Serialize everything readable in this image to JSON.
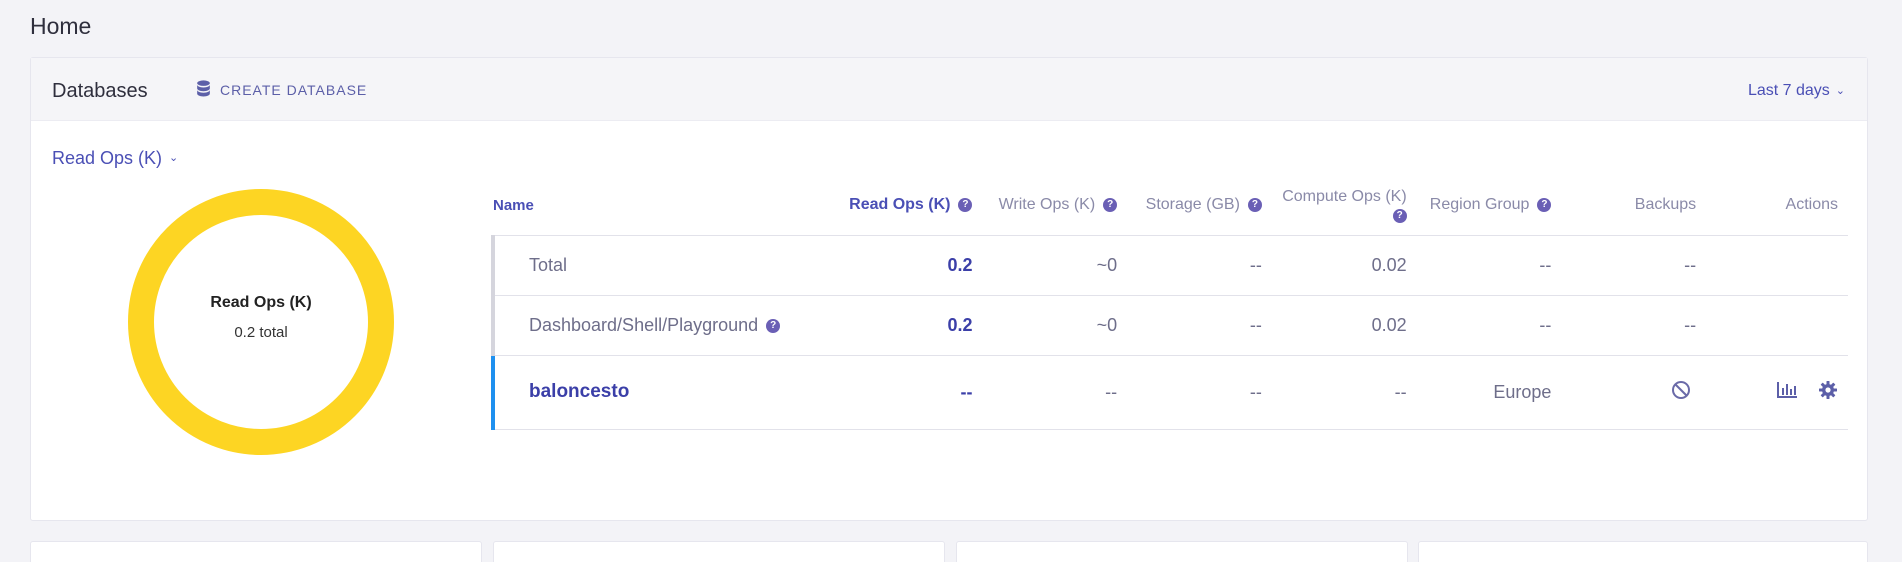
{
  "page": {
    "title": "Home"
  },
  "card": {
    "title": "Databases",
    "create_button": "CREATE DATABASE",
    "range": "Last 7 days"
  },
  "metric_select": {
    "label": "Read Ops (K)"
  },
  "donut": {
    "title": "Read Ops (K)",
    "subtitle": "0.2 total",
    "color": "#fdd523"
  },
  "table": {
    "headers": {
      "name": "Name",
      "read_ops": "Read Ops (K)",
      "write_ops": "Write Ops (K)",
      "storage": "Storage (GB)",
      "compute_ops": "Compute Ops (K)",
      "region_group": "Region Group",
      "backups": "Backups",
      "actions": "Actions"
    },
    "help_glyph": "?",
    "rows": [
      {
        "name": "Total",
        "read_ops": "0.2",
        "write_ops": "~0",
        "storage": "--",
        "compute_ops": "0.02",
        "region_group": "--",
        "backups": "--"
      },
      {
        "name": "Dashboard/Shell/Playground",
        "read_ops": "0.2",
        "write_ops": "~0",
        "storage": "--",
        "compute_ops": "0.02",
        "region_group": "--",
        "backups": "--"
      },
      {
        "name": "baloncesto",
        "read_ops": "--",
        "write_ops": "--",
        "storage": "--",
        "compute_ops": "--",
        "region_group": "Europe",
        "backups": "disabled-icon"
      }
    ]
  },
  "colors": {
    "accent": "#4a4fb5",
    "selected_row": "#1e90ef",
    "help_icon": "#6a5fb5"
  }
}
